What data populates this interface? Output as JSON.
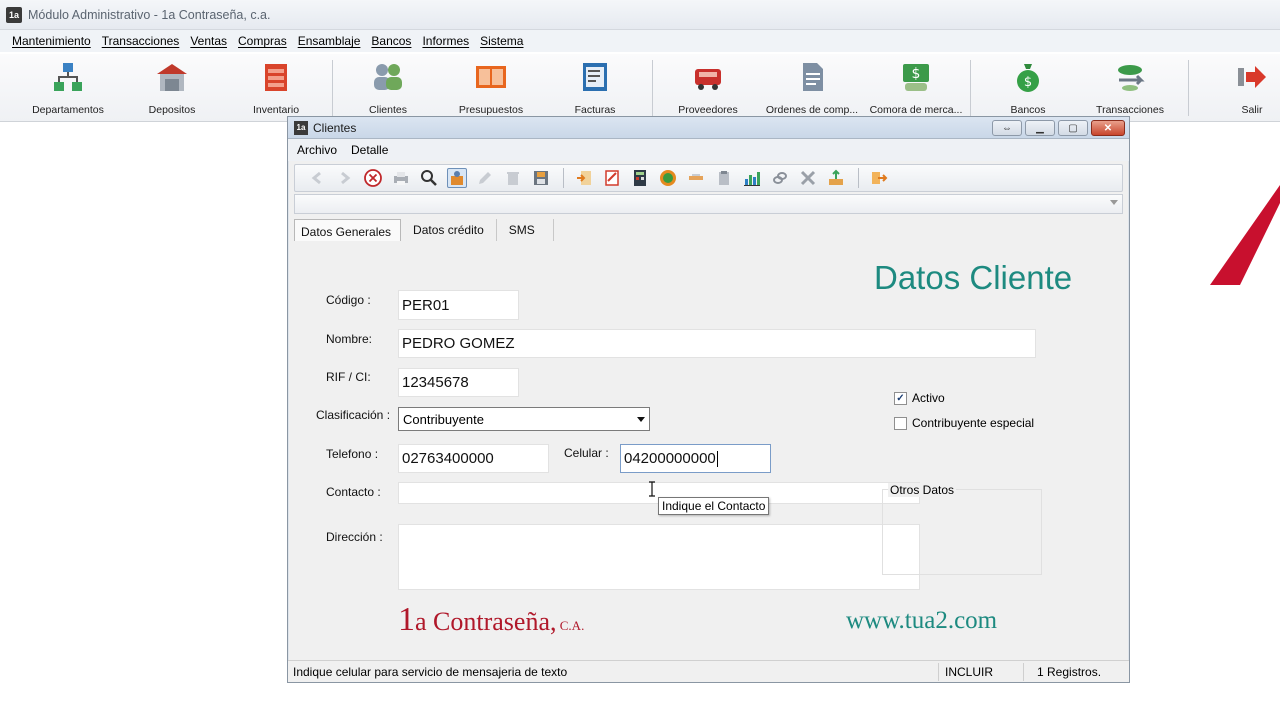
{
  "app": {
    "title": "Módulo Administrativo - 1a Contraseña, c.a.",
    "menu": [
      "Mantenimiento",
      "Transacciones",
      "Ventas",
      "Compras",
      "Ensamblaje",
      "Bancos",
      "Informes",
      "Sistema"
    ],
    "toolbar": {
      "departamentos": "Departamentos",
      "depositos": "Depositos",
      "inventario": "Inventario",
      "clientes": "Clientes",
      "presupuestos": "Presupuestos",
      "facturas": "Facturas",
      "proveedores": "Proveedores",
      "ordenes": "Ordenes de comp...",
      "compra_merca": "Comora de merca...",
      "bancos": "Bancos",
      "transacciones": "Transacciones",
      "salir": "Salir"
    }
  },
  "window": {
    "title": "Clientes",
    "menu": [
      "Archivo",
      "Detalle"
    ],
    "tabs": [
      "Datos Generales",
      "Datos crédito",
      "SMS"
    ],
    "heading": "Datos Cliente",
    "form": {
      "codigo_label": "Código :",
      "codigo_value": "PER01",
      "nombre_label": "Nombre:",
      "nombre_value": "PEDRO GOMEZ",
      "rif_label": "RIF / CI:",
      "rif_value": "12345678",
      "clasificacion_label": "Clasificación :",
      "clasificacion_value": "Contribuyente",
      "telefono_label": "Telefono :",
      "telefono_value": "02763400000",
      "celular_label": "Celular :",
      "celular_value": "04200000000",
      "contacto_label": "Contacto :",
      "contacto_value": "",
      "direccion_label": "Dirección :",
      "direccion_value": ""
    },
    "otros": {
      "title": "Otros Datos",
      "activo_label": "Activo",
      "activo_checked": true,
      "especial_label": "Contribuyente especial",
      "especial_checked": false
    },
    "tooltip": "Indique el Contacto",
    "brand": {
      "one": "1",
      "name": "a Contraseña,",
      "ca": " C.A.",
      "web": "www.tua2.com"
    },
    "status": {
      "message": "Indique celular para servicio de mensajeria de texto",
      "mode": "INCLUIR",
      "records": "1 Registros."
    }
  },
  "colors": {
    "accent_teal": "#1d8a80",
    "brand_red": "#b0182a"
  }
}
